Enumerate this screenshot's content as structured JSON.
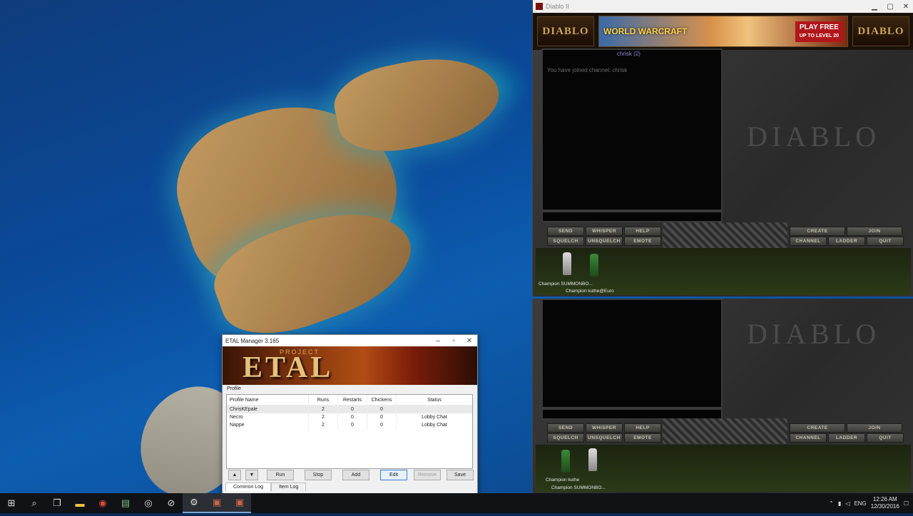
{
  "desktop": {
    "wallpaper": "coastal-island-aerial"
  },
  "diablo_window": {
    "title": "Diablo II",
    "banner_logo": "DIABLO",
    "ad": {
      "brand": "WORLD WARCRAFT",
      "cta": "PLAY FREE",
      "cta_sub": "UP TO LEVEL 20"
    },
    "channel_title": "chrisk (2)",
    "join_message": "You have joined channel: chrisk",
    "watermark": "DIABLO",
    "left_buttons_top": [
      "SEND",
      "WHISPER",
      "HELP"
    ],
    "left_buttons_bottom": [
      "SQUELCH",
      "UNSQUELCH",
      "EMOTE"
    ],
    "right_buttons_top": [
      "CREATE",
      "JOIN"
    ],
    "right_buttons_bottom": [
      "CHANNEL",
      "LADDER",
      "QUIT"
    ],
    "chars_top": [
      "Champion SUMMONBO...",
      "Champion kuthe@Euro"
    ],
    "chars_bottom": [
      "Champion kuthe",
      "Champion SUMMONBO..."
    ]
  },
  "etal": {
    "title": "ETAL Manager 3.165",
    "banner_small": "PROJECT",
    "banner_big": "ETAL",
    "profile_label": "Profile",
    "columns": [
      "Profile Name",
      "Runs",
      "Restarts",
      "Chickens",
      "Status"
    ],
    "rows": [
      {
        "name": "ChrisKEpale",
        "runs": "2",
        "restarts": "0",
        "chickens": "0",
        "status": ""
      },
      {
        "name": "Necro",
        "runs": "2",
        "restarts": "0",
        "chickens": "0",
        "status": "Lobby Chat"
      },
      {
        "name": "Nappe",
        "runs": "2",
        "restarts": "0",
        "chickens": "0",
        "status": "Lobby Chat"
      }
    ],
    "buttons": {
      "run": "Run",
      "stop": "Stop",
      "add": "Add",
      "edit": "Edit",
      "remove": "Remove",
      "save": "Save"
    },
    "tabs": [
      "Common Log",
      "Item Log"
    ]
  },
  "taskbar": {
    "lang": "ENG",
    "time": "12:26 AM",
    "date": "12/30/2016"
  }
}
